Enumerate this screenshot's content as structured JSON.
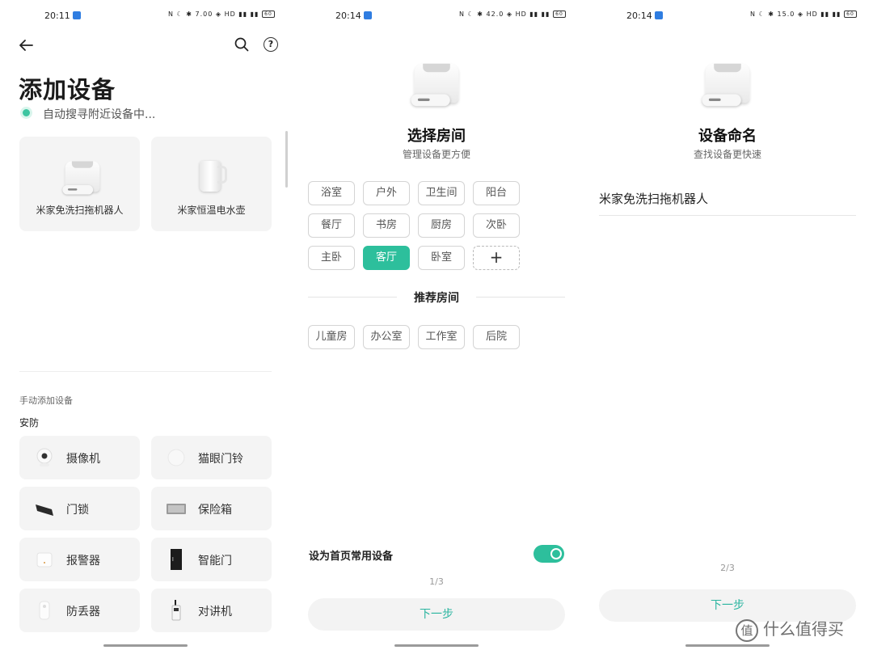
{
  "screen1": {
    "status_time": "20:11",
    "status_right": "N ☾ ✱ 7.00 ◈ HD ▮▮ ▮▮",
    "battery": "60",
    "title": "添加设备",
    "scan_status": "自动搜寻附近设备中...",
    "found_devices": [
      {
        "label": "米家免洗扫拖机器人",
        "icon": "robot-vacuum-icon"
      },
      {
        "label": "米家恒温电水壶",
        "icon": "kettle-icon"
      }
    ],
    "manual_label": "手动添加设备",
    "category": "安防",
    "devices": [
      {
        "label": "摄像机",
        "icon": "camera-icon"
      },
      {
        "label": "猫眼门铃",
        "icon": "doorbell-icon"
      },
      {
        "label": "门锁",
        "icon": "door-lock-icon"
      },
      {
        "label": "保险箱",
        "icon": "safe-icon"
      },
      {
        "label": "报警器",
        "icon": "alarm-icon"
      },
      {
        "label": "智能门",
        "icon": "smart-door-icon"
      },
      {
        "label": "防丢器",
        "icon": "anti-loss-icon"
      },
      {
        "label": "对讲机",
        "icon": "walkie-talkie-icon"
      }
    ]
  },
  "screen2": {
    "status_time": "20:14",
    "status_right": "N ☾ ✱ 42.0 ◈ HD ▮▮ ▮▮",
    "battery": "60",
    "title": "选择房间",
    "subtitle": "管理设备更方便",
    "rooms": [
      "浴室",
      "户外",
      "卫生间",
      "阳台",
      "餐厅",
      "书房",
      "厨房",
      "次卧",
      "主卧",
      "客厅",
      "卧室"
    ],
    "selected_room": "客厅",
    "add_symbol": "+",
    "recommended_title": "推荐房间",
    "recommended": [
      "儿童房",
      "办公室",
      "工作室",
      "后院"
    ],
    "toggle_label": "设为首页常用设备",
    "toggle_on": true,
    "step": "1/3",
    "next_label": "下一步",
    "accent": "#2dbf9c"
  },
  "screen3": {
    "status_time": "20:14",
    "status_right": "N ☾ ✱ 15.0 ◈ HD ▮▮ ▮▮",
    "battery": "60",
    "title": "设备命名",
    "subtitle": "查找设备更快速",
    "device_name": "米家免洗扫拖机器人",
    "step": "2/3",
    "next_label": "下一步",
    "watermark": "什么值得买",
    "watermark_logo": "值"
  }
}
